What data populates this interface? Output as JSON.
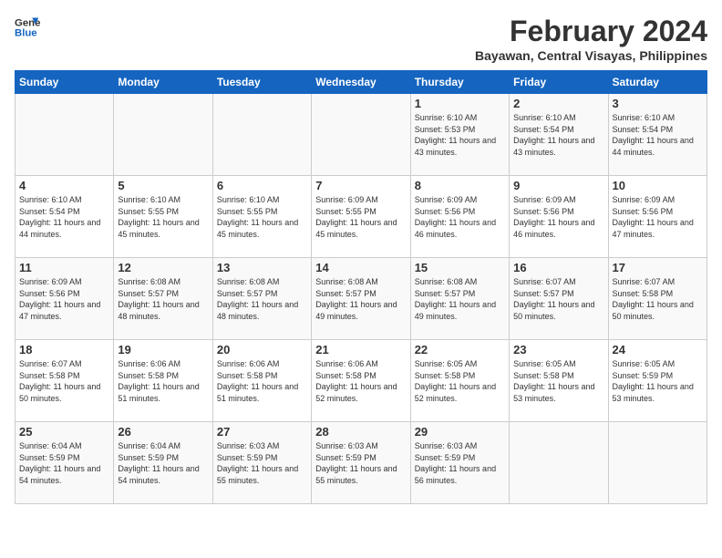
{
  "header": {
    "logo_line1": "General",
    "logo_line2": "Blue",
    "month_year": "February 2024",
    "location": "Bayawan, Central Visayas, Philippines"
  },
  "days_of_week": [
    "Sunday",
    "Monday",
    "Tuesday",
    "Wednesday",
    "Thursday",
    "Friday",
    "Saturday"
  ],
  "weeks": [
    [
      {
        "day": "",
        "sunrise": "",
        "sunset": "",
        "daylight": ""
      },
      {
        "day": "",
        "sunrise": "",
        "sunset": "",
        "daylight": ""
      },
      {
        "day": "",
        "sunrise": "",
        "sunset": "",
        "daylight": ""
      },
      {
        "day": "",
        "sunrise": "",
        "sunset": "",
        "daylight": ""
      },
      {
        "day": "1",
        "sunrise": "Sunrise: 6:10 AM",
        "sunset": "Sunset: 5:53 PM",
        "daylight": "Daylight: 11 hours and 43 minutes."
      },
      {
        "day": "2",
        "sunrise": "Sunrise: 6:10 AM",
        "sunset": "Sunset: 5:54 PM",
        "daylight": "Daylight: 11 hours and 43 minutes."
      },
      {
        "day": "3",
        "sunrise": "Sunrise: 6:10 AM",
        "sunset": "Sunset: 5:54 PM",
        "daylight": "Daylight: 11 hours and 44 minutes."
      }
    ],
    [
      {
        "day": "4",
        "sunrise": "Sunrise: 6:10 AM",
        "sunset": "Sunset: 5:54 PM",
        "daylight": "Daylight: 11 hours and 44 minutes."
      },
      {
        "day": "5",
        "sunrise": "Sunrise: 6:10 AM",
        "sunset": "Sunset: 5:55 PM",
        "daylight": "Daylight: 11 hours and 45 minutes."
      },
      {
        "day": "6",
        "sunrise": "Sunrise: 6:10 AM",
        "sunset": "Sunset: 5:55 PM",
        "daylight": "Daylight: 11 hours and 45 minutes."
      },
      {
        "day": "7",
        "sunrise": "Sunrise: 6:09 AM",
        "sunset": "Sunset: 5:55 PM",
        "daylight": "Daylight: 11 hours and 45 minutes."
      },
      {
        "day": "8",
        "sunrise": "Sunrise: 6:09 AM",
        "sunset": "Sunset: 5:56 PM",
        "daylight": "Daylight: 11 hours and 46 minutes."
      },
      {
        "day": "9",
        "sunrise": "Sunrise: 6:09 AM",
        "sunset": "Sunset: 5:56 PM",
        "daylight": "Daylight: 11 hours and 46 minutes."
      },
      {
        "day": "10",
        "sunrise": "Sunrise: 6:09 AM",
        "sunset": "Sunset: 5:56 PM",
        "daylight": "Daylight: 11 hours and 47 minutes."
      }
    ],
    [
      {
        "day": "11",
        "sunrise": "Sunrise: 6:09 AM",
        "sunset": "Sunset: 5:56 PM",
        "daylight": "Daylight: 11 hours and 47 minutes."
      },
      {
        "day": "12",
        "sunrise": "Sunrise: 6:08 AM",
        "sunset": "Sunset: 5:57 PM",
        "daylight": "Daylight: 11 hours and 48 minutes."
      },
      {
        "day": "13",
        "sunrise": "Sunrise: 6:08 AM",
        "sunset": "Sunset: 5:57 PM",
        "daylight": "Daylight: 11 hours and 48 minutes."
      },
      {
        "day": "14",
        "sunrise": "Sunrise: 6:08 AM",
        "sunset": "Sunset: 5:57 PM",
        "daylight": "Daylight: 11 hours and 49 minutes."
      },
      {
        "day": "15",
        "sunrise": "Sunrise: 6:08 AM",
        "sunset": "Sunset: 5:57 PM",
        "daylight": "Daylight: 11 hours and 49 minutes."
      },
      {
        "day": "16",
        "sunrise": "Sunrise: 6:07 AM",
        "sunset": "Sunset: 5:57 PM",
        "daylight": "Daylight: 11 hours and 50 minutes."
      },
      {
        "day": "17",
        "sunrise": "Sunrise: 6:07 AM",
        "sunset": "Sunset: 5:58 PM",
        "daylight": "Daylight: 11 hours and 50 minutes."
      }
    ],
    [
      {
        "day": "18",
        "sunrise": "Sunrise: 6:07 AM",
        "sunset": "Sunset: 5:58 PM",
        "daylight": "Daylight: 11 hours and 50 minutes."
      },
      {
        "day": "19",
        "sunrise": "Sunrise: 6:06 AM",
        "sunset": "Sunset: 5:58 PM",
        "daylight": "Daylight: 11 hours and 51 minutes."
      },
      {
        "day": "20",
        "sunrise": "Sunrise: 6:06 AM",
        "sunset": "Sunset: 5:58 PM",
        "daylight": "Daylight: 11 hours and 51 minutes."
      },
      {
        "day": "21",
        "sunrise": "Sunrise: 6:06 AM",
        "sunset": "Sunset: 5:58 PM",
        "daylight": "Daylight: 11 hours and 52 minutes."
      },
      {
        "day": "22",
        "sunrise": "Sunrise: 6:05 AM",
        "sunset": "Sunset: 5:58 PM",
        "daylight": "Daylight: 11 hours and 52 minutes."
      },
      {
        "day": "23",
        "sunrise": "Sunrise: 6:05 AM",
        "sunset": "Sunset: 5:58 PM",
        "daylight": "Daylight: 11 hours and 53 minutes."
      },
      {
        "day": "24",
        "sunrise": "Sunrise: 6:05 AM",
        "sunset": "Sunset: 5:59 PM",
        "daylight": "Daylight: 11 hours and 53 minutes."
      }
    ],
    [
      {
        "day": "25",
        "sunrise": "Sunrise: 6:04 AM",
        "sunset": "Sunset: 5:59 PM",
        "daylight": "Daylight: 11 hours and 54 minutes."
      },
      {
        "day": "26",
        "sunrise": "Sunrise: 6:04 AM",
        "sunset": "Sunset: 5:59 PM",
        "daylight": "Daylight: 11 hours and 54 minutes."
      },
      {
        "day": "27",
        "sunrise": "Sunrise: 6:03 AM",
        "sunset": "Sunset: 5:59 PM",
        "daylight": "Daylight: 11 hours and 55 minutes."
      },
      {
        "day": "28",
        "sunrise": "Sunrise: 6:03 AM",
        "sunset": "Sunset: 5:59 PM",
        "daylight": "Daylight: 11 hours and 55 minutes."
      },
      {
        "day": "29",
        "sunrise": "Sunrise: 6:03 AM",
        "sunset": "Sunset: 5:59 PM",
        "daylight": "Daylight: 11 hours and 56 minutes."
      },
      {
        "day": "",
        "sunrise": "",
        "sunset": "",
        "daylight": ""
      },
      {
        "day": "",
        "sunrise": "",
        "sunset": "",
        "daylight": ""
      }
    ]
  ]
}
